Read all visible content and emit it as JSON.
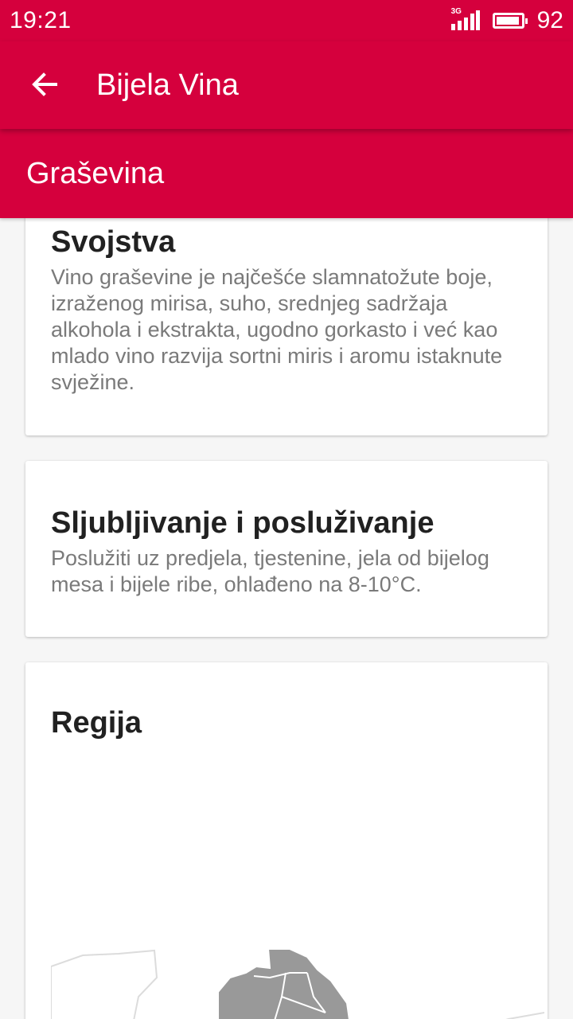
{
  "status_bar": {
    "time": "19:21",
    "network_type": "3G",
    "battery_percent": "92",
    "battery_level": 0.92
  },
  "toolbar": {
    "back_icon": "arrow-left-icon",
    "title": "Bijela Vina"
  },
  "sub_header": {
    "title": "Graševina"
  },
  "cards": {
    "properties": {
      "title": "Svojstva",
      "text": "Vino graševine je najčešće slamnatožute boje, izraženog mirisa, suho, srednjeg sadržaja alkohola i ekstrakta, ugodno gorkasto i već kao mlado vino razvija sortni miris i aromu istaknute svježine."
    },
    "pairing": {
      "title": "Sljubljivanje i posluživanje",
      "text": "Poslužiti uz predjela, tjestenine, jela od bijelog mesa i bijele ribe, ohlađeno na 8-10°C."
    },
    "region": {
      "title": "Regija"
    }
  },
  "colors": {
    "primary": "#d5003d",
    "card_background": "#ffffff",
    "page_background": "#f6f6f6",
    "title_text": "#212121",
    "body_text": "#7a7a7a",
    "map_region_fill": "#999999"
  }
}
